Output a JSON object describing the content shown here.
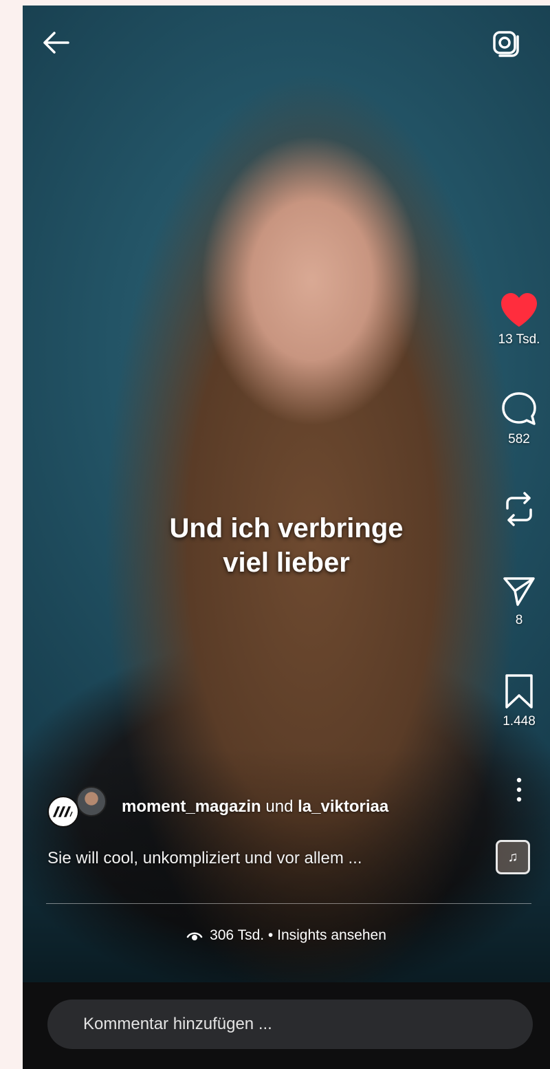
{
  "caption": {
    "line1": "Und ich verbringe",
    "line2": "viel lieber"
  },
  "actions": {
    "likes": "13 Tsd.",
    "comments": "582",
    "shares": "8",
    "saves": "1.448"
  },
  "author": {
    "username": "moment_magazin",
    "joiner": " und ",
    "collaborator": "la_viktoriaa",
    "logo_text": "/\\/\\"
  },
  "description": "Sie will cool, unkompliziert und vor allem ...",
  "insights": {
    "views": "306 Tsd.",
    "separator": " • ",
    "link_label": "Insights ansehen"
  },
  "comment_input": {
    "placeholder": "Kommentar hinzufügen ..."
  },
  "icons": {
    "back": "arrow-left-icon",
    "camera": "camera-icon",
    "like": "heart-icon",
    "comment": "comment-bubble-icon",
    "repost": "repost-icon",
    "share": "send-icon",
    "save": "bookmark-icon",
    "more": "more-vertical-icon",
    "audio": "music-note-icon",
    "views": "eye-icon"
  },
  "colors": {
    "like_active": "#ff2d3d",
    "comment_bar": "#0e0e0f",
    "comment_input": "#2a2b2e"
  }
}
